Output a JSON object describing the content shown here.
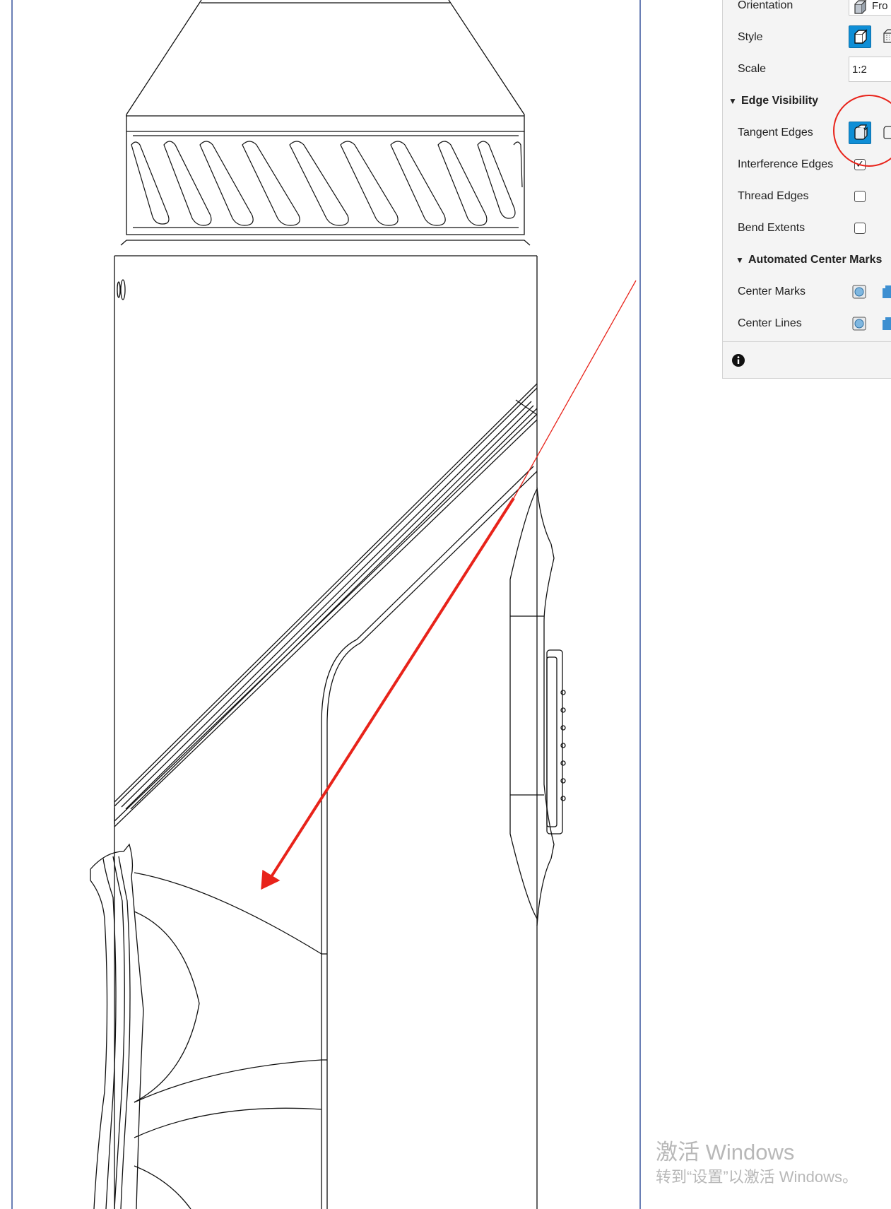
{
  "panel": {
    "orientation": {
      "label": "Orientation",
      "value": "Fro"
    },
    "style": {
      "label": "Style"
    },
    "scale": {
      "label": "Scale",
      "value": "1:2"
    },
    "edge_visibility": {
      "heading": "Edge Visibility",
      "tangent_edges": {
        "label": "Tangent Edges",
        "active": true
      },
      "interference_edges": {
        "label": "Interference Edges",
        "checked": true
      },
      "thread_edges": {
        "label": "Thread Edges",
        "checked": false
      },
      "bend_extents": {
        "label": "Bend Extents",
        "checked": false
      }
    },
    "center_marks": {
      "heading": "Automated Center Marks",
      "center_marks_label": "Center Marks",
      "center_lines_label": "Center Lines"
    },
    "info_icon": "info-icon"
  },
  "annotation": {
    "color": "#e8231a"
  },
  "accent_color": "#0f8ed6",
  "watermark": {
    "line1": "激活 Windows",
    "line2": "转到“设置”以激活 Windows。"
  }
}
